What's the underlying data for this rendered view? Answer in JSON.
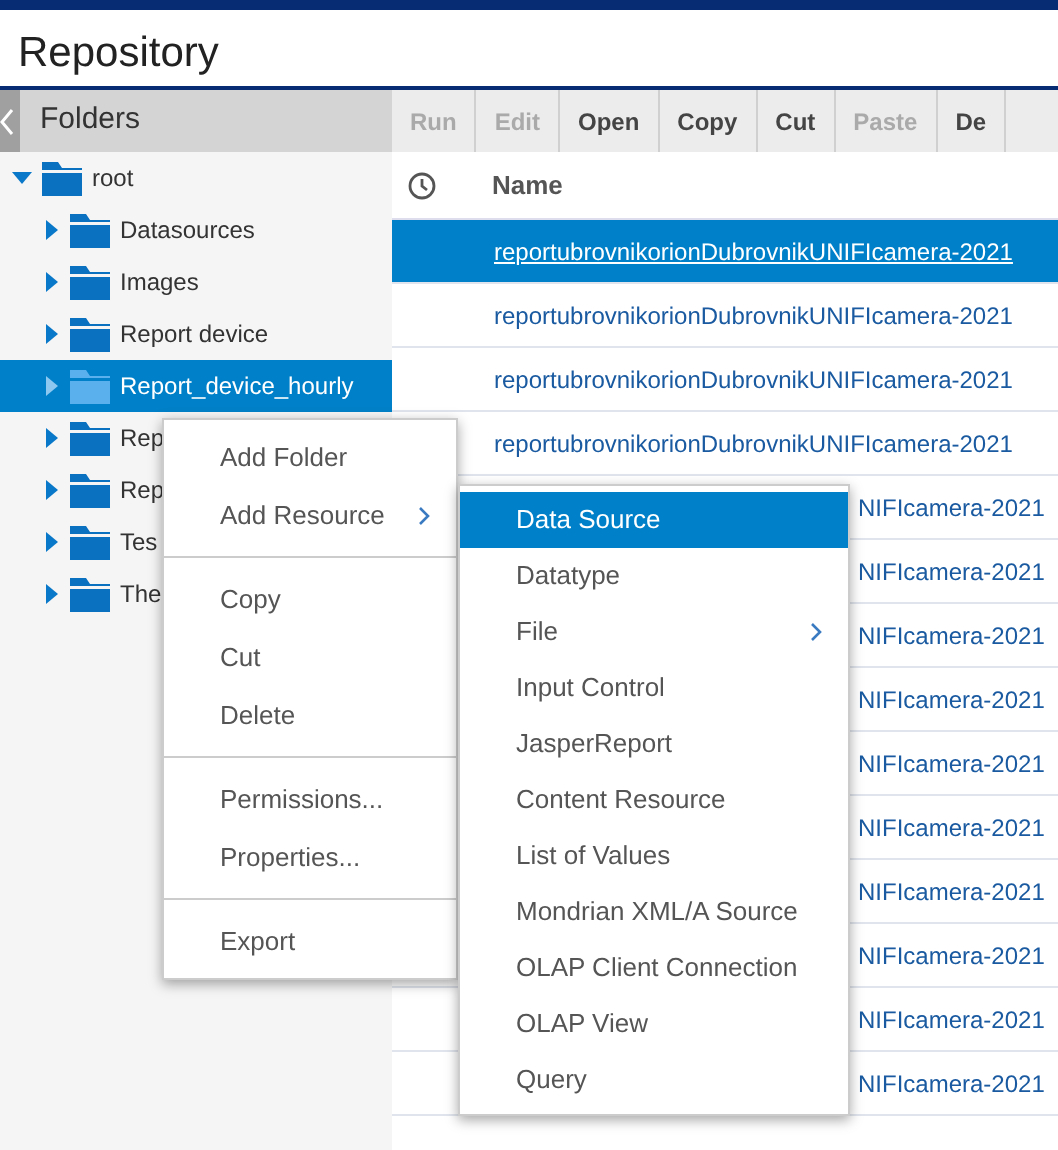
{
  "title": "Repository",
  "folders_panel": {
    "header": "Folders"
  },
  "tree": [
    {
      "name": "root",
      "expanded": true,
      "selected": false,
      "children": [
        {
          "name": "Datasources",
          "expanded": false,
          "selected": false
        },
        {
          "name": "Images",
          "expanded": false,
          "selected": false
        },
        {
          "name": "Report device",
          "expanded": false,
          "selected": false
        },
        {
          "name": "Report_device_hourly",
          "expanded": false,
          "selected": true
        },
        {
          "name": "Rep",
          "expanded": false,
          "selected": false
        },
        {
          "name": "Rep",
          "expanded": false,
          "selected": false
        },
        {
          "name": "Tes",
          "expanded": false,
          "selected": false
        },
        {
          "name": "The",
          "expanded": false,
          "selected": false
        }
      ]
    }
  ],
  "toolbar": [
    {
      "label": "Run",
      "disabled": true
    },
    {
      "label": "Edit",
      "disabled": true
    },
    {
      "label": "Open",
      "disabled": false
    },
    {
      "label": "Copy",
      "disabled": false
    },
    {
      "label": "Cut",
      "disabled": false
    },
    {
      "label": "Paste",
      "disabled": true
    },
    {
      "label": "De",
      "disabled": false
    }
  ],
  "table": {
    "columns": [
      "Name"
    ],
    "rows": [
      {
        "name": "reportubrovnikorionDubrovnikUNIFIcamera-2021",
        "selected": true,
        "kind": "full"
      },
      {
        "name": "reportubrovnikorionDubrovnikUNIFIcamera-2021",
        "selected": false,
        "kind": "full"
      },
      {
        "name": "reportubrovnikorionDubrovnikUNIFIcamera-2021",
        "selected": false,
        "kind": "full"
      },
      {
        "name": "reportubrovnikorionDubrovnikUNIFIcamera-2021",
        "selected": false,
        "kind": "full"
      },
      {
        "name": "NIFIcamera-2021",
        "selected": false,
        "kind": "partial"
      },
      {
        "name": "NIFIcamera-2021",
        "selected": false,
        "kind": "partial"
      },
      {
        "name": "NIFIcamera-2021",
        "selected": false,
        "kind": "partial"
      },
      {
        "name": "NIFIcamera-2021",
        "selected": false,
        "kind": "partial"
      },
      {
        "name": "NIFIcamera-2021",
        "selected": false,
        "kind": "partial"
      },
      {
        "name": "NIFIcamera-2021",
        "selected": false,
        "kind": "partial"
      },
      {
        "name": "NIFIcamera-2021",
        "selected": false,
        "kind": "partial"
      },
      {
        "name": "NIFIcamera-2021",
        "selected": false,
        "kind": "partial"
      },
      {
        "name": "NIFIcamera-2021",
        "selected": false,
        "kind": "partial"
      },
      {
        "name": "NIFIcamera-2021",
        "selected": false,
        "kind": "partial"
      }
    ]
  },
  "context_menu": {
    "groups": [
      [
        {
          "label": "Add Folder",
          "submenu": false
        },
        {
          "label": "Add Resource",
          "submenu": true
        }
      ],
      [
        {
          "label": "Copy",
          "submenu": false
        },
        {
          "label": "Cut",
          "submenu": false
        },
        {
          "label": "Delete",
          "submenu": false
        }
      ],
      [
        {
          "label": "Permissions...",
          "submenu": false
        },
        {
          "label": "Properties...",
          "submenu": false
        }
      ],
      [
        {
          "label": "Export",
          "submenu": false
        }
      ]
    ]
  },
  "submenu": [
    {
      "label": "Data Source",
      "selected": true,
      "submenu": false
    },
    {
      "label": "Datatype",
      "selected": false,
      "submenu": false
    },
    {
      "label": "File",
      "selected": false,
      "submenu": true
    },
    {
      "label": "Input Control",
      "selected": false,
      "submenu": false
    },
    {
      "label": "JasperReport",
      "selected": false,
      "submenu": false
    },
    {
      "label": "Content Resource",
      "selected": false,
      "submenu": false
    },
    {
      "label": "List of Values",
      "selected": false,
      "submenu": false
    },
    {
      "label": "Mondrian XML/A Source",
      "selected": false,
      "submenu": false
    },
    {
      "label": "OLAP Client Connection",
      "selected": false,
      "submenu": false
    },
    {
      "label": "OLAP View",
      "selected": false,
      "submenu": false
    },
    {
      "label": "Query",
      "selected": false,
      "submenu": false
    }
  ]
}
